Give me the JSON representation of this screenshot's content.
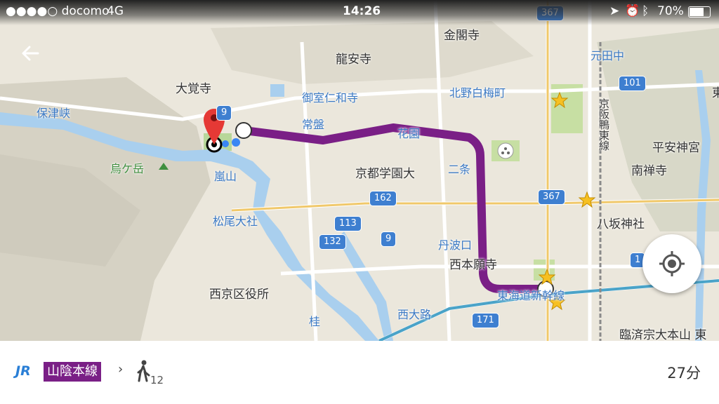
{
  "status_bar": {
    "carrier": "●●●●○ docomo",
    "network": "4G",
    "time": "14:26",
    "battery": "70%"
  },
  "map": {
    "places": {
      "kinkakuji": "金閣寺",
      "ryoanji": "龍安寺",
      "daikakuji": "大覚寺",
      "omuro_ninnaji": "御室仁和寺",
      "kitano_hakubaicho": "北野白梅町",
      "motatanaka": "元田中",
      "hozukyo": "保津峡",
      "tokiwa": "常盤",
      "hanazono": "花園",
      "karasugatake": "烏ケ岳",
      "arashiyama": "嵐山",
      "kyoto_gakuendai": "京都学園大",
      "nijo": "二条",
      "heian_jingu": "平安神宮",
      "nanzenji": "南禅寺",
      "matsuo_taisha": "松尾大社",
      "yasaka_jinja": "八坂神社",
      "tambaguchi": "丹波口",
      "nishi_honganji": "西本願寺",
      "nishikyo_kuyakusho": "西京区役所",
      "tokaido_shinkansen": "東海道新幹線",
      "nishioji": "西大路",
      "katsura": "桂",
      "rinzaishu": "臨済宗大本山 東",
      "keihan": "京阪鴨東線",
      "higashi": "東"
    },
    "route_shields": [
      "367",
      "101",
      "9",
      "162",
      "367",
      "113",
      "132",
      "9",
      "171",
      "1"
    ],
    "route_color": "#7a1f86"
  },
  "trip": {
    "operator": "JR",
    "line_name": "山陰本線",
    "walk_minutes": "12",
    "duration": "27分"
  }
}
